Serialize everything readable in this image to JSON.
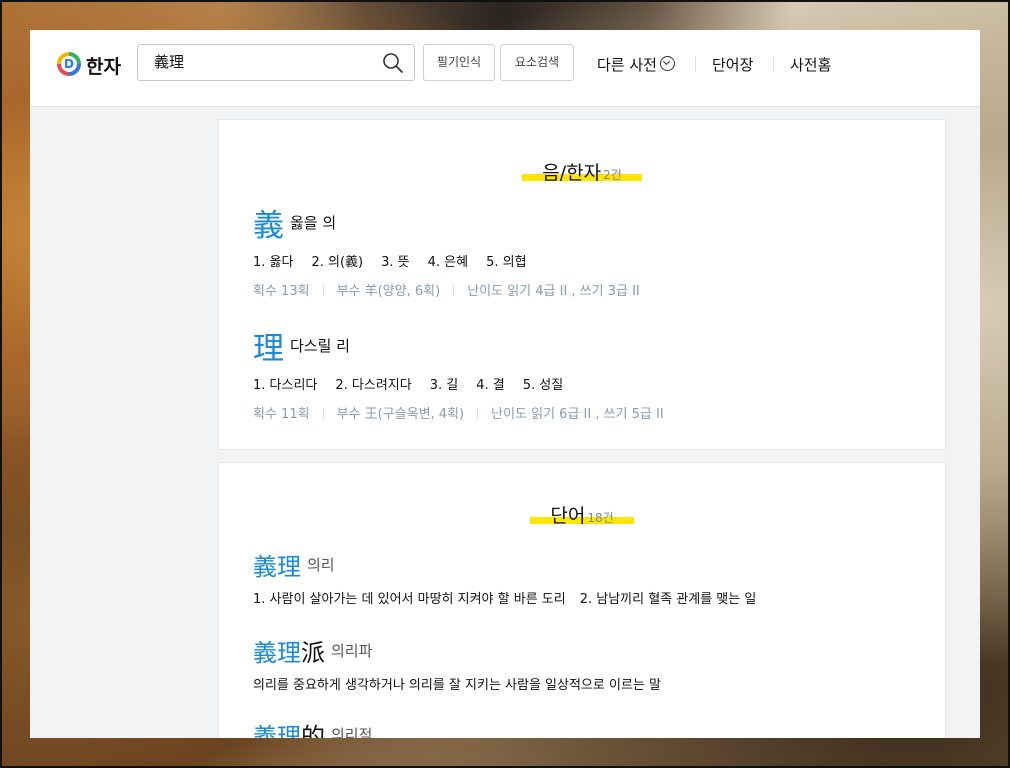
{
  "header": {
    "brand": "한자",
    "search_value": "義理",
    "handwriting_label": "필기인식",
    "component_search_label": "요소검색",
    "nav": [
      "다른 사전",
      "단어장",
      "사전홈"
    ]
  },
  "hanja_section": {
    "title": "음/한자",
    "count": "2건",
    "items": [
      {
        "char": "義",
        "meaning": "옳을 의",
        "defs": [
          "1. 옳다",
          "2. 의(義)",
          "3. 뜻",
          "4. 은혜",
          "5. 의협"
        ],
        "strokes": "획수 13획",
        "radical": "부수 羊(양양, 6획)",
        "level": "난이도 읽기 4급 II , 쓰기 3급 II"
      },
      {
        "char": "理",
        "meaning": "다스릴 리",
        "defs": [
          "1. 다스리다",
          "2. 다스려지다",
          "3. 길",
          "4. 결",
          "5. 성질"
        ],
        "strokes": "획수 11획",
        "radical": "부수 王(구슬옥변, 4획)",
        "level": "난이도 읽기 6급 II , 쓰기 5급 II"
      }
    ]
  },
  "word_section": {
    "title": "단어",
    "count": "18건",
    "items": [
      {
        "hanja_main": "義理",
        "hanja_extra": "",
        "reading": "의리",
        "defs": [
          "1. 사람이 살아가는 데 있어서 마땅히 지켜야 할 바른 도리",
          "2. 남남끼리 혈족 관계를 맺는 일"
        ]
      },
      {
        "hanja_main": "義理",
        "hanja_extra": "派",
        "reading": "의리파",
        "defs": [
          "의리를 중요하게 생각하거나 의리를 잘 지키는 사람을 일상적으로 이르는 말"
        ]
      },
      {
        "hanja_main": "義理",
        "hanja_extra": "的",
        "reading": "의리적",
        "defs": []
      }
    ]
  }
}
